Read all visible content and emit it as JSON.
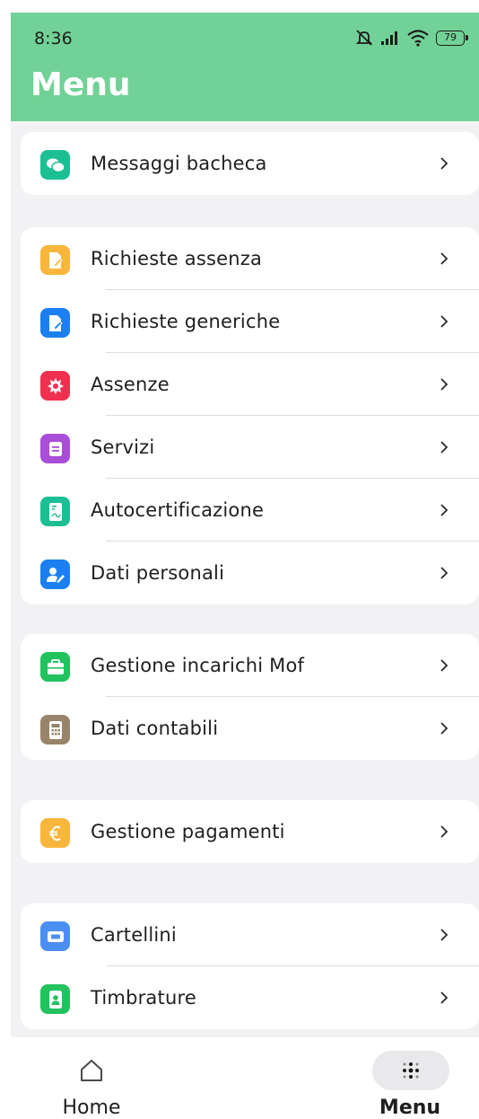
{
  "status_bar": {
    "time": "8:36",
    "battery": "79"
  },
  "header": {
    "title": "Menu"
  },
  "colors": {
    "header_bg": "#72d196",
    "teal": "#1cbf94",
    "orange": "#f8b63c",
    "blue": "#1b7ff0",
    "red": "#f0304f",
    "purple": "#a94ed8",
    "green": "#22c25e",
    "brown": "#98846a"
  },
  "groups": [
    {
      "items": [
        {
          "label": "Messaggi bacheca",
          "icon": "chat-bubbles-icon",
          "color": "#1cbf94"
        }
      ]
    },
    {
      "items": [
        {
          "label": "Richieste assenza",
          "icon": "document-edit-icon",
          "color": "#f8b63c"
        },
        {
          "label": "Richieste generiche",
          "icon": "document-edit-icon",
          "color": "#1b7ff0"
        },
        {
          "label": "Assenze",
          "icon": "badge-gear-icon",
          "color": "#f0304f"
        },
        {
          "label": "Servizi",
          "icon": "list-card-icon",
          "color": "#a94ed8"
        },
        {
          "label": "Autocertificazione",
          "icon": "certificate-doc-icon",
          "color": "#1cbf94"
        },
        {
          "label": "Dati personali",
          "icon": "user-edit-icon",
          "color": "#1b7ff0"
        }
      ]
    },
    {
      "items": [
        {
          "label": "Gestione incarichi Mof",
          "icon": "briefcase-icon",
          "color": "#22c25e"
        },
        {
          "label": "Dati contabili",
          "icon": "calculator-icon",
          "color": "#98846a"
        }
      ]
    },
    {
      "items": [
        {
          "label": "Gestione pagamenti",
          "icon": "euro-icon",
          "color": "#f8b63c"
        }
      ]
    },
    {
      "items": [
        {
          "label": "Cartellini",
          "icon": "ticket-card-icon",
          "color": "#4b8ff2"
        },
        {
          "label": "Timbrature",
          "icon": "id-badge-icon",
          "color": "#22c25e"
        }
      ]
    }
  ],
  "bottom_nav": {
    "home_label": "Home",
    "menu_label": "Menu"
  }
}
